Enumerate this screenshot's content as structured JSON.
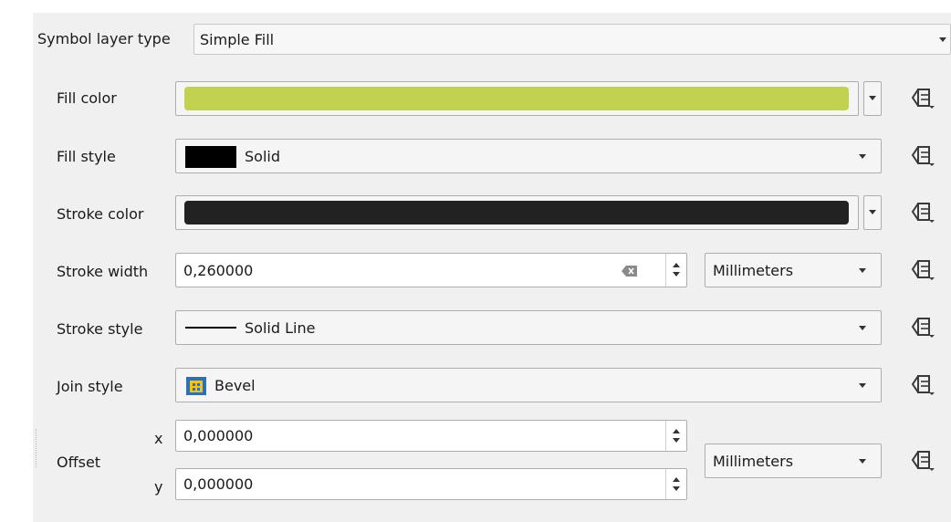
{
  "symbol_layer_type": {
    "label": "Symbol layer type",
    "value": "Simple Fill"
  },
  "fill_color": {
    "label": "Fill color",
    "color": "#c2d14f"
  },
  "fill_style": {
    "label": "Fill style",
    "value": "Solid"
  },
  "stroke_color": {
    "label": "Stroke color",
    "color": "#222222"
  },
  "stroke_width": {
    "label": "Stroke width",
    "value": "0,260000",
    "unit": "Millimeters"
  },
  "stroke_style": {
    "label": "Stroke style",
    "value": "Solid Line"
  },
  "join_style": {
    "label": "Join style",
    "value": "Bevel"
  },
  "offset": {
    "label": "Offset",
    "x_label": "x",
    "x_value": "0,000000",
    "y_label": "y",
    "y_value": "0,000000",
    "unit": "Millimeters"
  },
  "icons": {
    "data_defined": "data-defined-override-icon",
    "clear": "clear-icon",
    "join": "join-bevel-icon"
  }
}
